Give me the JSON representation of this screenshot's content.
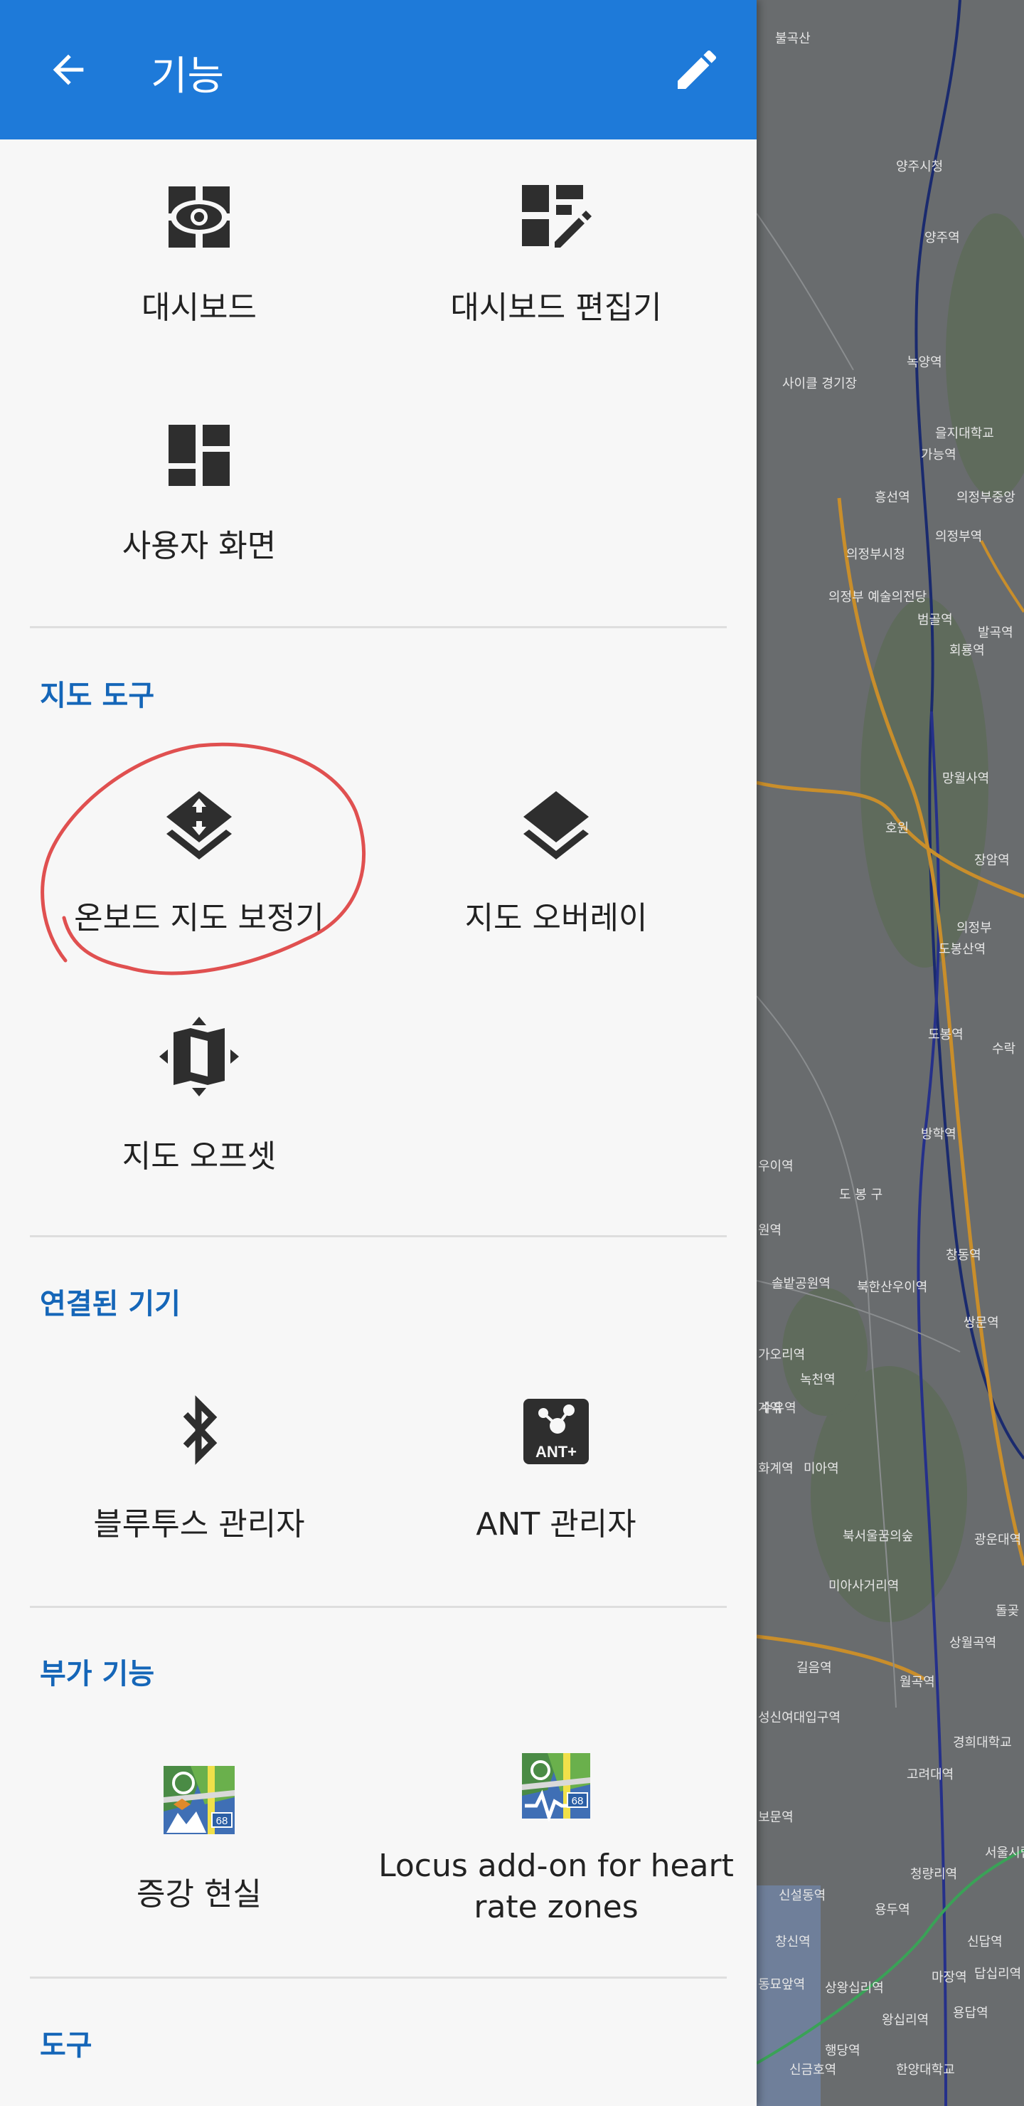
{
  "app_bar": {
    "title": "기능",
    "back_icon": "arrow-back-icon",
    "edit_icon": "pencil-edit-icon",
    "color": "#1e7ad9"
  },
  "tiles_top": [
    {
      "label": "대시보드",
      "icon": "dashboard-eye-icon"
    },
    {
      "label": "대시보드 편집기",
      "icon": "dashboard-editor-icon"
    },
    {
      "label": "사용자 화면",
      "icon": "custom-screen-icon"
    }
  ],
  "sections": [
    {
      "title": "지도 도구",
      "items": [
        {
          "label": "온보드 지도 보정기",
          "icon": "layers-calibrate-icon"
        },
        {
          "label": "지도 오버레이",
          "icon": "layers-icon"
        },
        {
          "label": "지도 오프셋",
          "icon": "map-offset-icon"
        }
      ]
    },
    {
      "title": "연결된 기기",
      "items": [
        {
          "label": "블루투스 관리자",
          "icon": "bluetooth-icon"
        },
        {
          "label": "ANT 관리자",
          "icon": "ant-plus-icon",
          "badge": "ANT+"
        }
      ]
    },
    {
      "title": "부가 기능",
      "items": [
        {
          "label": "증강 현실",
          "icon": "augmented-reality-addon-icon"
        },
        {
          "label": "Locus add-on for heart rate zones",
          "icon": "heart-rate-addon-icon",
          "badge": "68"
        }
      ]
    },
    {
      "title": "도구",
      "items": []
    }
  ],
  "map_labels": [
    "불곡산",
    "양주시청",
    "양주역",
    "녹양역",
    "사이클 경기장",
    "을지대학교",
    "가능역",
    "흥선역",
    "의정부중앙",
    "의정부역",
    "의정부시청",
    "의정부 예술의전당",
    "범골역",
    "발곡역",
    "회룡역",
    "망월사역",
    "호원",
    "장암역",
    "의정부",
    "도봉산역",
    "도봉역",
    "수락",
    "방학역",
    "우이역",
    "도 봉 구",
    "창동역",
    "원역",
    "솔밭공원역",
    "북한산우이역",
    "쌍문역",
    "녹천역",
    "수유역",
    "계역",
    "가오리역",
    "화계역",
    "미아역",
    "북서울꿈의숲",
    "광운대역",
    "미아사거리역",
    "돌곶",
    "길음역",
    "월곡역",
    "상월곡역",
    "성신여대입구역",
    "고려대역",
    "경희대학교",
    "보문역",
    "서울시립대학",
    "신설동역",
    "청량리역",
    "용두역",
    "신답역",
    "창신역",
    "마장역",
    "답십리역",
    "동묘앞역",
    "상왕십리역",
    "왕십리역",
    "용답역",
    "행당역",
    "신금호역",
    "한양대학교"
  ],
  "annotation": {
    "color": "#e05050",
    "target": "온보드 지도 보정기"
  }
}
